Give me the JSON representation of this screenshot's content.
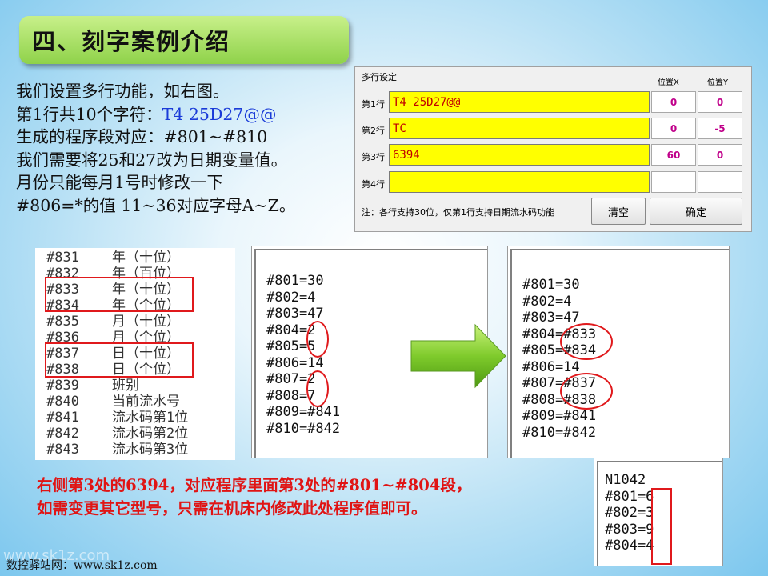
{
  "slide": {
    "title": "四、刻字案例介绍",
    "intro_lines": [
      {
        "pre": "我们设置多行功能，如右图。",
        "hl": ""
      },
      {
        "pre": "第1行共10个字符：",
        "hl": "T4 25D27@@"
      },
      {
        "pre": "生成的程序段对应：#801~#810",
        "hl": ""
      },
      {
        "pre": "我们需要将25和27改为日期变量值。",
        "hl": ""
      },
      {
        "pre": "月份只能每月1号时修改一下",
        "hl": ""
      },
      {
        "pre": "#806=*的值 11~36对应字母A~Z。",
        "hl": ""
      }
    ],
    "bottom_text": [
      "右侧第3处的6394，对应程序里面第3处的#801~#804段，",
      "如需变更其它型号，只需在机床内修改此处程序值即可。"
    ],
    "footer": "数控驿站网：www.sk1z.com",
    "watermark": "www.sk1z.com"
  },
  "dialog": {
    "group_label": "多行设定",
    "col_x": "位置X",
    "col_y": "位置Y",
    "rows": [
      {
        "label": "第1行",
        "text": "T4 25D27@@",
        "x": "0",
        "y": "0"
      },
      {
        "label": "第2行",
        "text": "TC",
        "x": "0",
        "y": "-5"
      },
      {
        "label": "第3行",
        "text": "6394",
        "x": "60",
        "y": "0"
      },
      {
        "label": "第4行",
        "text": "",
        "x": "",
        "y": ""
      }
    ],
    "note": "注：各行支持30位，仅第1行支持日期流水码功能",
    "clear_button": "清空",
    "ok_button": "确定"
  },
  "variable_table": [
    {
      "code": "#831",
      "desc": "年（十位）"
    },
    {
      "code": "#832",
      "desc": "年（百位）"
    },
    {
      "code": "#833",
      "desc": "年（十位）"
    },
    {
      "code": "#834",
      "desc": "年（个位）"
    },
    {
      "code": "#835",
      "desc": "月（十位）"
    },
    {
      "code": "#836",
      "desc": "月（个位）"
    },
    {
      "code": "#837",
      "desc": "日（十位）"
    },
    {
      "code": "#838",
      "desc": "日（个位）"
    },
    {
      "code": "#839",
      "desc": "班别"
    },
    {
      "code": "#840",
      "desc": "当前流水号"
    },
    {
      "code": "#841",
      "desc": "流水码第1位"
    },
    {
      "code": "#842",
      "desc": "流水码第2位"
    },
    {
      "code": "#843",
      "desc": "流水码第3位"
    }
  ],
  "program_before": [
    "#801=30",
    "#802=4",
    "#803=47",
    "#804=2",
    "#805=5",
    "#806=14",
    "#807=2",
    "#808=7",
    "#809=#841",
    "#810=#842"
  ],
  "program_after": [
    "#801=30",
    "#802=4",
    "#803=47",
    "#804=#833",
    "#805=#834",
    "#806=14",
    "#807=#837",
    "#808=#838",
    "#809=#841",
    "#810=#842"
  ],
  "program_small": [
    "N1042",
    "#801=6",
    "#802=3",
    "#803=9",
    "#804=4"
  ],
  "colors": {
    "title_green": "#8fd24a",
    "highlight_blue": "#1a3bd8",
    "annotation_red": "#e0191c",
    "input_yellow": "#ffff00"
  }
}
